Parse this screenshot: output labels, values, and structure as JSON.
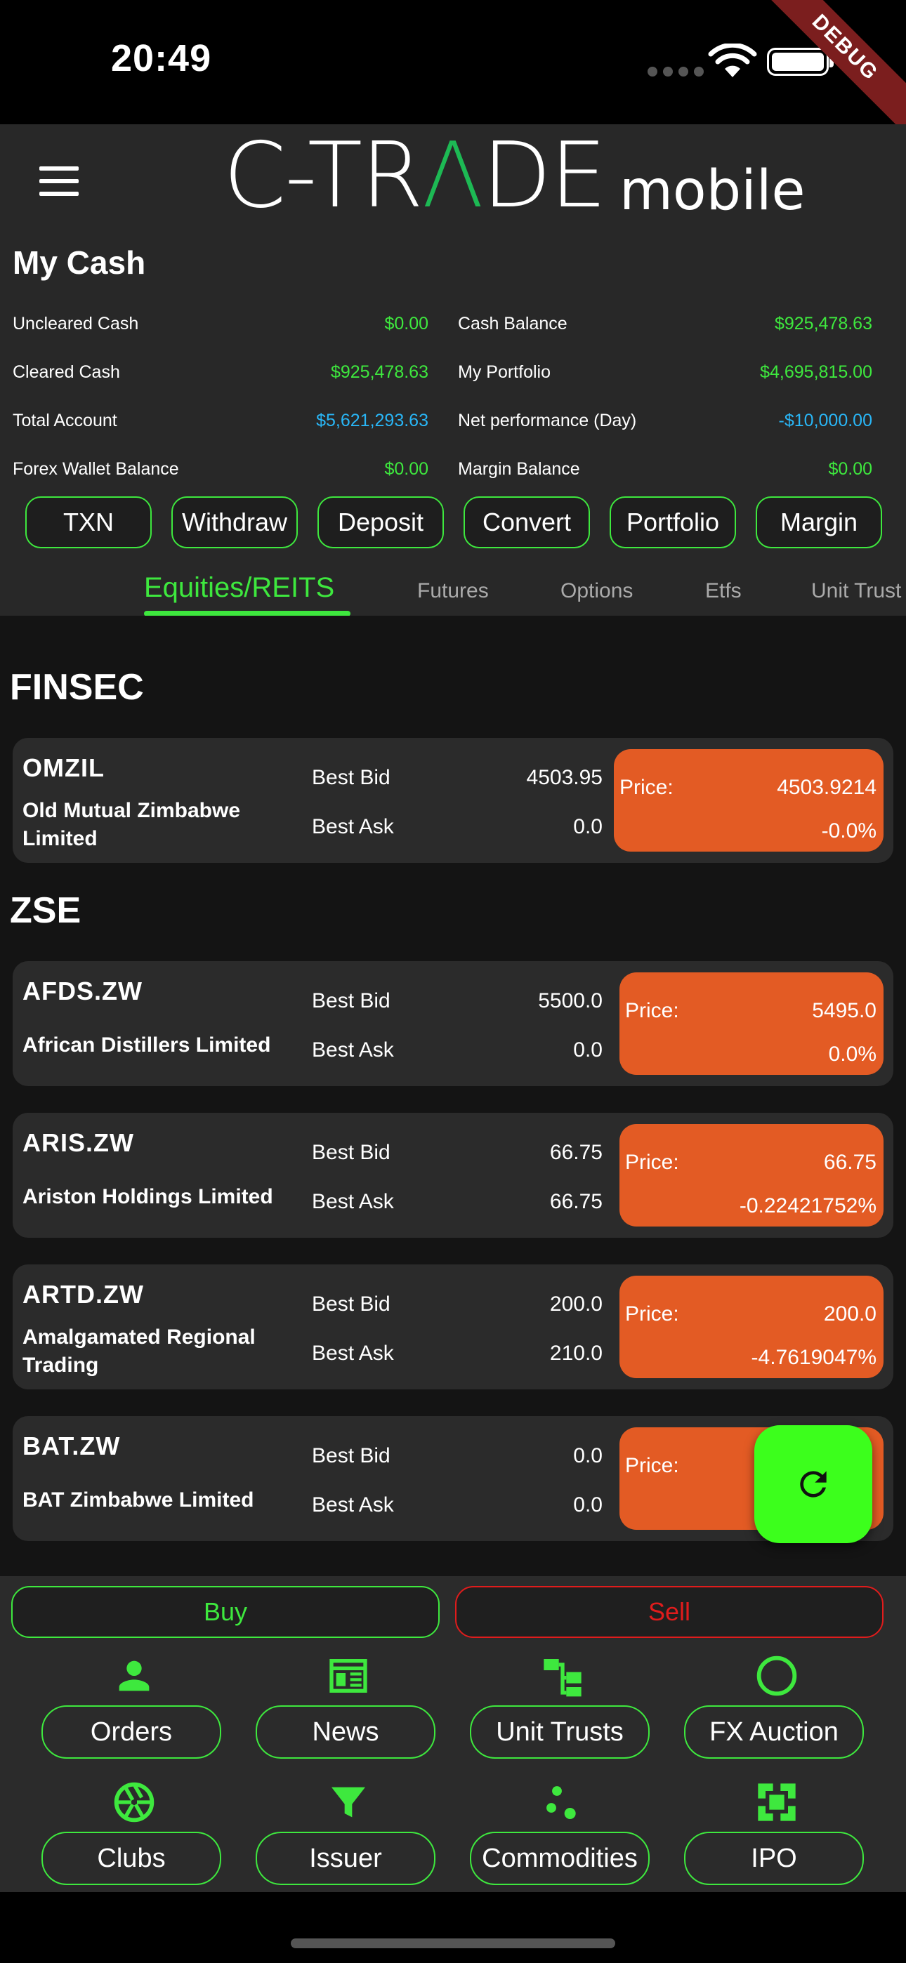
{
  "status_bar": {
    "time": "20:49",
    "debug_label": "DEBUG"
  },
  "header": {
    "logo_c": "C-TR",
    "logo_a": "Λ",
    "logo_de": "DE",
    "logo_sub": "mobile"
  },
  "cash": {
    "title": "My Cash",
    "rows": [
      {
        "label": "Uncleared Cash",
        "value": "$0.00"
      },
      {
        "label": "Cash Balance",
        "value": "$925,478.63"
      },
      {
        "label": "Cleared Cash",
        "value": "$925,478.63"
      },
      {
        "label": "My Portfolio",
        "value": "$4,695,815.00"
      },
      {
        "label": "Total Account",
        "value": "$5,621,293.63"
      },
      {
        "label": "Net performance (Day)",
        "value": "-$10,000.00"
      },
      {
        "label": "Forex Wallet Balance",
        "value": "$0.00"
      },
      {
        "label": "Margin Balance",
        "value": "$0.00"
      }
    ],
    "actions": [
      "TXN",
      "Withdraw",
      "Deposit",
      "Convert",
      "Portfolio",
      "Margin"
    ]
  },
  "tabs": [
    "Equities/REITS",
    "Futures",
    "Options",
    "Etfs",
    "Unit Trust"
  ],
  "market": {
    "best_bid_label": "Best Bid",
    "best_ask_label": "Best Ask",
    "price_label": "Price:",
    "sections": [
      {
        "name": "FINSEC"
      },
      {
        "name": "ZSE"
      }
    ],
    "securities": [
      {
        "ticker": "OMZIL",
        "name": "Old Mutual Zimbabwe Limited",
        "best_bid": "4503.95",
        "best_ask": "0.0",
        "price": "4503.9214",
        "change": "-0.0%"
      },
      {
        "ticker": "AFDS.ZW",
        "name": "African Distillers Limited",
        "best_bid": "5500.0",
        "best_ask": "0.0",
        "price": "5495.0",
        "change": "0.0%"
      },
      {
        "ticker": "ARIS.ZW",
        "name": "Ariston Holdings Limited",
        "best_bid": "66.75",
        "best_ask": "66.75",
        "price": "66.75",
        "change": "-0.22421752%"
      },
      {
        "ticker": "ARTD.ZW",
        "name": "Amalgamated Regional Trading",
        "best_bid": "200.0",
        "best_ask": "210.0",
        "price": "200.0",
        "change": "-4.7619047%"
      },
      {
        "ticker": "BAT.ZW",
        "name": "BAT Zimbabwe Limited",
        "best_bid": "0.0",
        "best_ask": "0.0",
        "price": "",
        "change": ""
      }
    ]
  },
  "trade": {
    "buy": "Buy",
    "sell": "Sell"
  },
  "nav": [
    {
      "label": "Orders",
      "icon": "person-icon"
    },
    {
      "label": "News",
      "icon": "newspaper-icon"
    },
    {
      "label": "Unit Trusts",
      "icon": "hierarchy-icon"
    },
    {
      "label": "FX Auction",
      "icon": "circle-icon"
    },
    {
      "label": "Clubs",
      "icon": "aperture-icon"
    },
    {
      "label": "Issuer",
      "icon": "filter-icon"
    },
    {
      "label": "Commodities",
      "icon": "scatter-icon"
    },
    {
      "label": "IPO",
      "icon": "fit-screen-icon"
    }
  ],
  "colors": {
    "accent": "#3ee83e",
    "price_box": "#e35b24",
    "sell": "#e01c1c",
    "fab": "#3cff1c",
    "negative": "#29b6f6"
  }
}
